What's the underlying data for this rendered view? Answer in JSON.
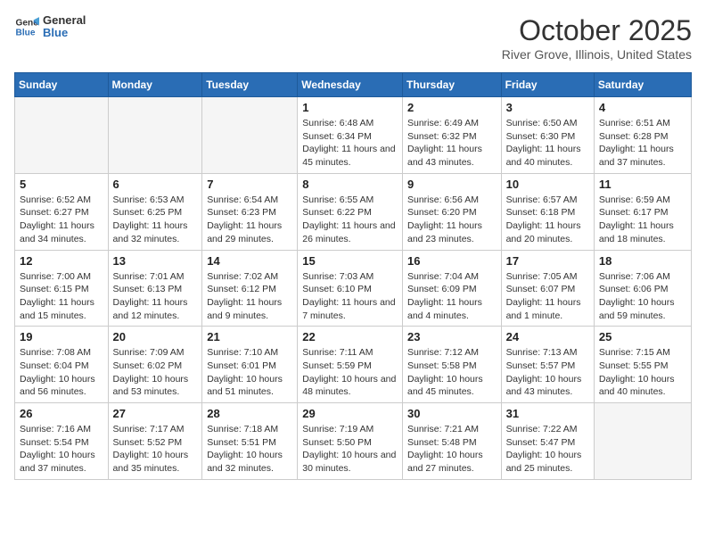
{
  "logo": {
    "line1": "General",
    "line2": "Blue"
  },
  "title": "October 2025",
  "subtitle": "River Grove, Illinois, United States",
  "days_of_week": [
    "Sunday",
    "Monday",
    "Tuesday",
    "Wednesday",
    "Thursday",
    "Friday",
    "Saturday"
  ],
  "weeks": [
    [
      {
        "day": "",
        "sunrise": "",
        "sunset": "",
        "daylight": "",
        "empty": true
      },
      {
        "day": "",
        "sunrise": "",
        "sunset": "",
        "daylight": "",
        "empty": true
      },
      {
        "day": "",
        "sunrise": "",
        "sunset": "",
        "daylight": "",
        "empty": true
      },
      {
        "day": "1",
        "sunrise": "6:48 AM",
        "sunset": "6:34 PM",
        "daylight": "11 hours and 45 minutes."
      },
      {
        "day": "2",
        "sunrise": "6:49 AM",
        "sunset": "6:32 PM",
        "daylight": "11 hours and 43 minutes."
      },
      {
        "day": "3",
        "sunrise": "6:50 AM",
        "sunset": "6:30 PM",
        "daylight": "11 hours and 40 minutes."
      },
      {
        "day": "4",
        "sunrise": "6:51 AM",
        "sunset": "6:28 PM",
        "daylight": "11 hours and 37 minutes."
      }
    ],
    [
      {
        "day": "5",
        "sunrise": "6:52 AM",
        "sunset": "6:27 PM",
        "daylight": "11 hours and 34 minutes."
      },
      {
        "day": "6",
        "sunrise": "6:53 AM",
        "sunset": "6:25 PM",
        "daylight": "11 hours and 32 minutes."
      },
      {
        "day": "7",
        "sunrise": "6:54 AM",
        "sunset": "6:23 PM",
        "daylight": "11 hours and 29 minutes."
      },
      {
        "day": "8",
        "sunrise": "6:55 AM",
        "sunset": "6:22 PM",
        "daylight": "11 hours and 26 minutes."
      },
      {
        "day": "9",
        "sunrise": "6:56 AM",
        "sunset": "6:20 PM",
        "daylight": "11 hours and 23 minutes."
      },
      {
        "day": "10",
        "sunrise": "6:57 AM",
        "sunset": "6:18 PM",
        "daylight": "11 hours and 20 minutes."
      },
      {
        "day": "11",
        "sunrise": "6:59 AM",
        "sunset": "6:17 PM",
        "daylight": "11 hours and 18 minutes."
      }
    ],
    [
      {
        "day": "12",
        "sunrise": "7:00 AM",
        "sunset": "6:15 PM",
        "daylight": "11 hours and 15 minutes."
      },
      {
        "day": "13",
        "sunrise": "7:01 AM",
        "sunset": "6:13 PM",
        "daylight": "11 hours and 12 minutes."
      },
      {
        "day": "14",
        "sunrise": "7:02 AM",
        "sunset": "6:12 PM",
        "daylight": "11 hours and 9 minutes."
      },
      {
        "day": "15",
        "sunrise": "7:03 AM",
        "sunset": "6:10 PM",
        "daylight": "11 hours and 7 minutes."
      },
      {
        "day": "16",
        "sunrise": "7:04 AM",
        "sunset": "6:09 PM",
        "daylight": "11 hours and 4 minutes."
      },
      {
        "day": "17",
        "sunrise": "7:05 AM",
        "sunset": "6:07 PM",
        "daylight": "11 hours and 1 minute."
      },
      {
        "day": "18",
        "sunrise": "7:06 AM",
        "sunset": "6:06 PM",
        "daylight": "10 hours and 59 minutes."
      }
    ],
    [
      {
        "day": "19",
        "sunrise": "7:08 AM",
        "sunset": "6:04 PM",
        "daylight": "10 hours and 56 minutes."
      },
      {
        "day": "20",
        "sunrise": "7:09 AM",
        "sunset": "6:02 PM",
        "daylight": "10 hours and 53 minutes."
      },
      {
        "day": "21",
        "sunrise": "7:10 AM",
        "sunset": "6:01 PM",
        "daylight": "10 hours and 51 minutes."
      },
      {
        "day": "22",
        "sunrise": "7:11 AM",
        "sunset": "5:59 PM",
        "daylight": "10 hours and 48 minutes."
      },
      {
        "day": "23",
        "sunrise": "7:12 AM",
        "sunset": "5:58 PM",
        "daylight": "10 hours and 45 minutes."
      },
      {
        "day": "24",
        "sunrise": "7:13 AM",
        "sunset": "5:57 PM",
        "daylight": "10 hours and 43 minutes."
      },
      {
        "day": "25",
        "sunrise": "7:15 AM",
        "sunset": "5:55 PM",
        "daylight": "10 hours and 40 minutes."
      }
    ],
    [
      {
        "day": "26",
        "sunrise": "7:16 AM",
        "sunset": "5:54 PM",
        "daylight": "10 hours and 37 minutes."
      },
      {
        "day": "27",
        "sunrise": "7:17 AM",
        "sunset": "5:52 PM",
        "daylight": "10 hours and 35 minutes."
      },
      {
        "day": "28",
        "sunrise": "7:18 AM",
        "sunset": "5:51 PM",
        "daylight": "10 hours and 32 minutes."
      },
      {
        "day": "29",
        "sunrise": "7:19 AM",
        "sunset": "5:50 PM",
        "daylight": "10 hours and 30 minutes."
      },
      {
        "day": "30",
        "sunrise": "7:21 AM",
        "sunset": "5:48 PM",
        "daylight": "10 hours and 27 minutes."
      },
      {
        "day": "31",
        "sunrise": "7:22 AM",
        "sunset": "5:47 PM",
        "daylight": "10 hours and 25 minutes."
      },
      {
        "day": "",
        "sunrise": "",
        "sunset": "",
        "daylight": "",
        "empty": true
      }
    ]
  ],
  "labels": {
    "sunrise_prefix": "Sunrise: ",
    "sunset_prefix": "Sunset: ",
    "daylight_prefix": "Daylight: "
  }
}
